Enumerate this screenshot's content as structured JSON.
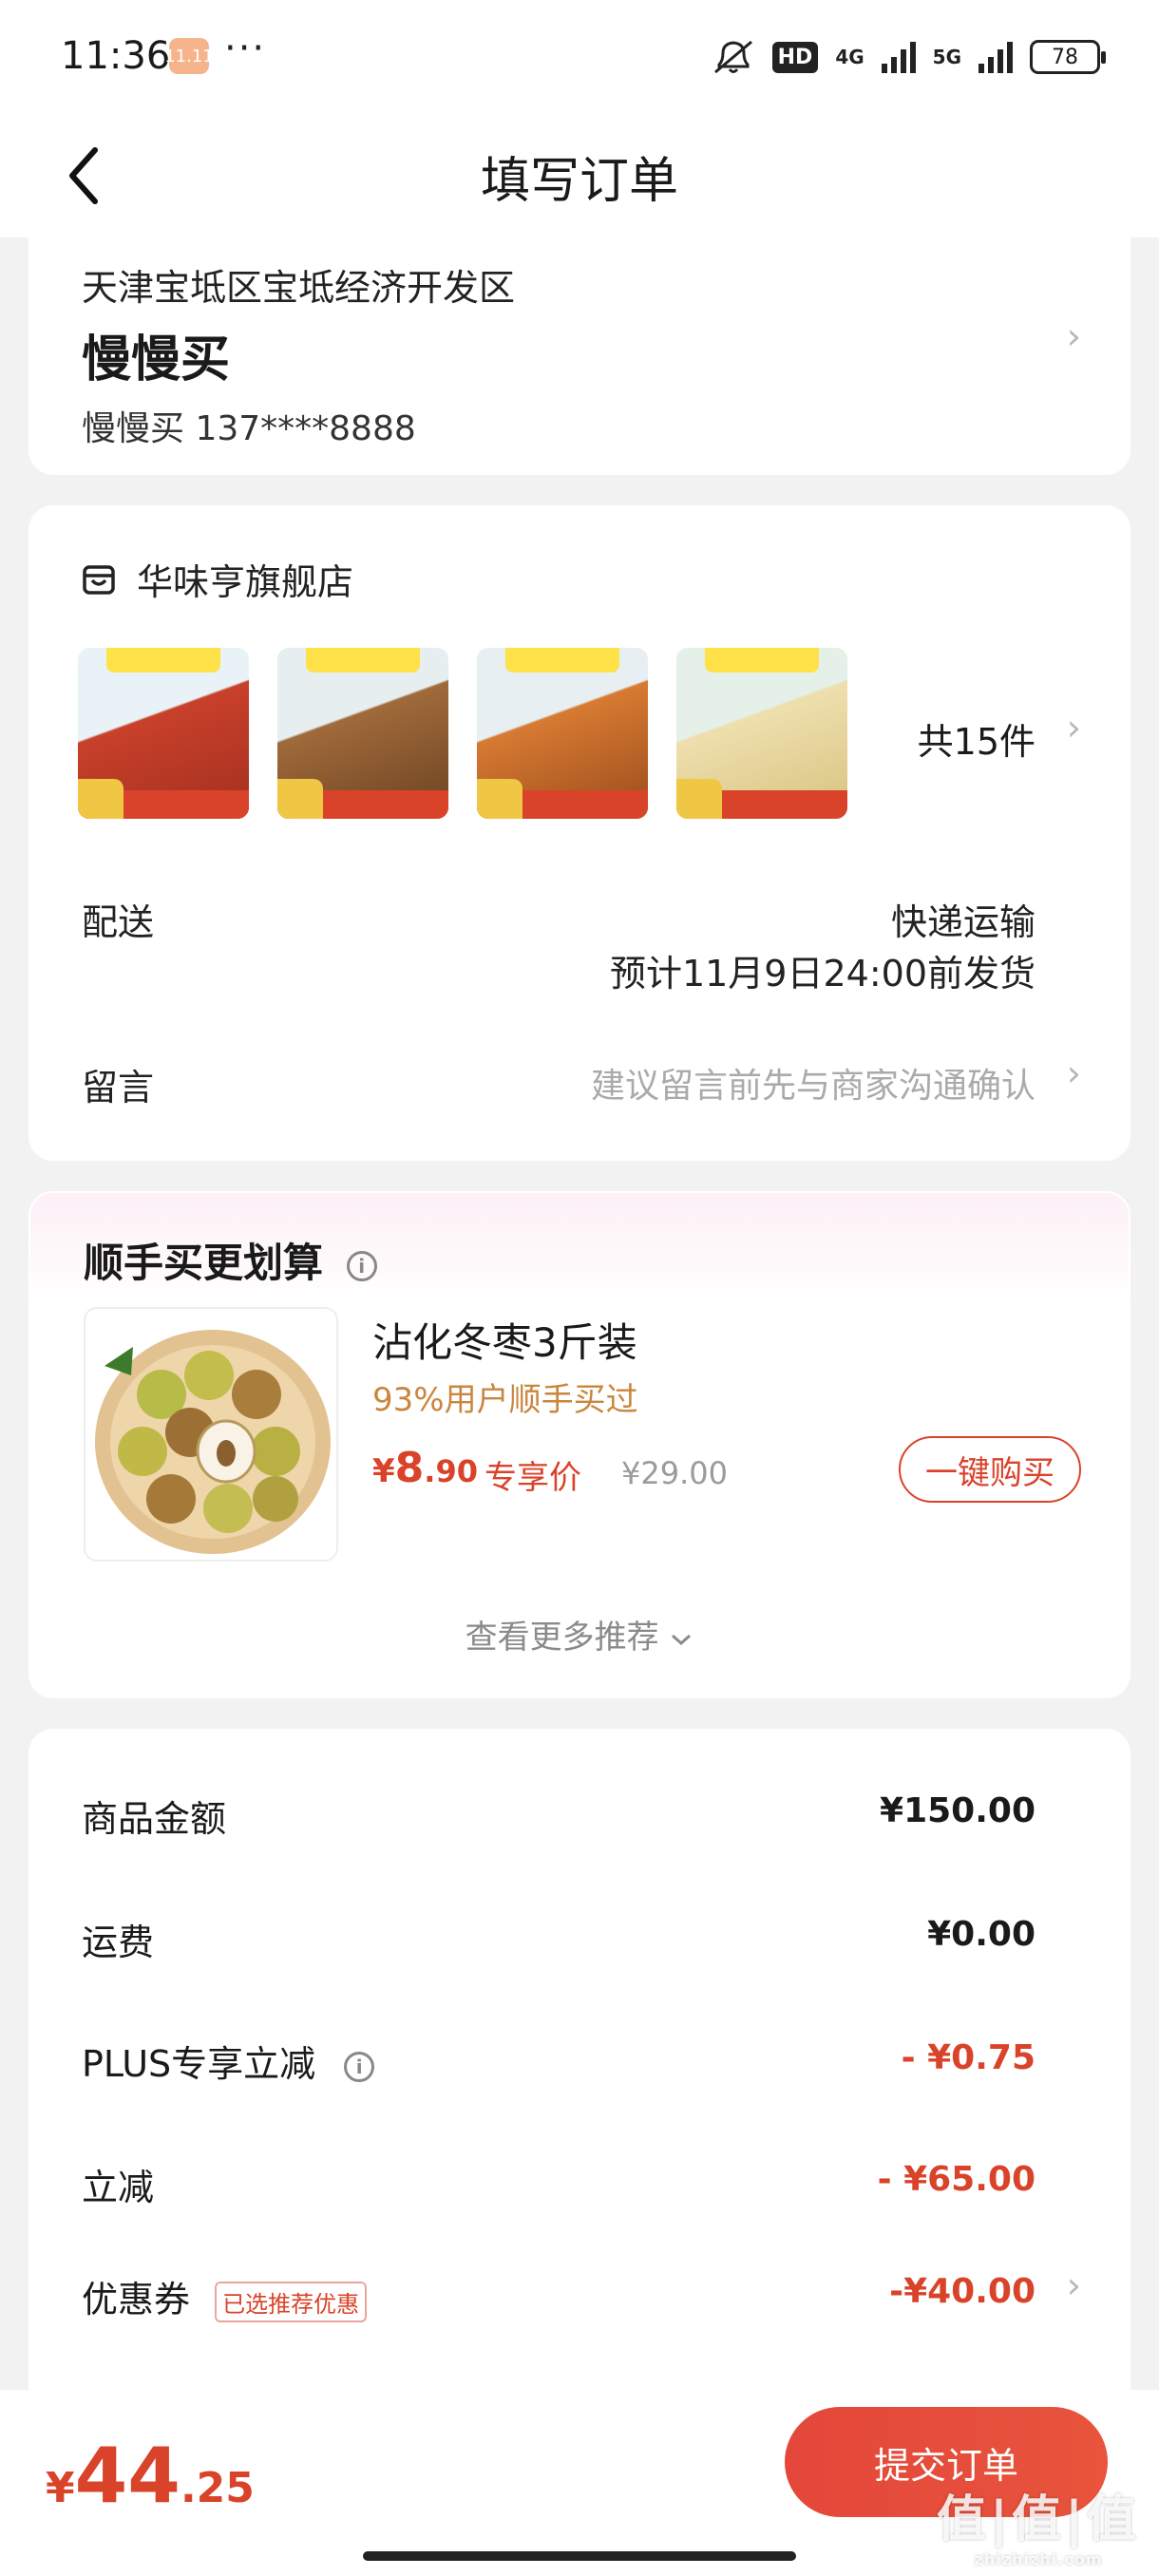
{
  "status_bar": {
    "time": "11:36",
    "app_badge": "11.11",
    "dots": "···",
    "hd": "HD",
    "net1": "4G",
    "net2": "5G",
    "battery": "78"
  },
  "header": {
    "title": "填写订单"
  },
  "address": {
    "region": "天津宝坻区宝坻经济开发区",
    "name": "慢慢买",
    "contact": "慢慢买  137****8888"
  },
  "shop": {
    "name": "华味亨旗舰店",
    "total_count": "共15件",
    "thumbnails": [
      {
        "name": "product-thumb-1",
        "color": "#c8402a"
      },
      {
        "name": "product-thumb-2",
        "color": "#8b5a2b"
      },
      {
        "name": "product-thumb-3",
        "color": "#c56a2b"
      },
      {
        "name": "product-thumb-4",
        "color": "#e8d59b"
      }
    ],
    "delivery_label": "配送",
    "delivery_method": "快递运输",
    "delivery_eta": "预计11月9日24:00前发货",
    "message_label": "留言",
    "message_placeholder": "建议留言前先与商家沟通确认"
  },
  "recommend": {
    "title": "顺手买更划算",
    "product_name": "沾化冬枣3斤装",
    "subtitle": "93%用户顺手买过",
    "price_currency": "¥",
    "price_int": "8",
    "price_dec": ".90",
    "price_label": "专享价",
    "original_price": "¥29.00",
    "buy_button": "一键购买",
    "more_link": "查看更多推荐"
  },
  "summary": {
    "items": [
      {
        "label": "商品金额",
        "value": "¥150.00"
      },
      {
        "label": "运费",
        "value": "¥0.00"
      },
      {
        "label": "PLUS专享立减",
        "value": "- ¥0.75"
      },
      {
        "label": "立减",
        "value": "- ¥65.00"
      },
      {
        "label": "优惠券",
        "value": "-¥40.00",
        "tag": "已选推荐优惠"
      }
    ]
  },
  "bottom": {
    "currency": "¥",
    "total_int": "44",
    "total_dec": ".25",
    "submit": "提交订单"
  },
  "watermark": {
    "text": "值|值|值",
    "sub": "zhizhizhi.com"
  },
  "colors": {
    "accent": "#d9432a",
    "background": "#f2f2f2",
    "hint": "#aaaaaa",
    "gold": "#c9863e"
  }
}
